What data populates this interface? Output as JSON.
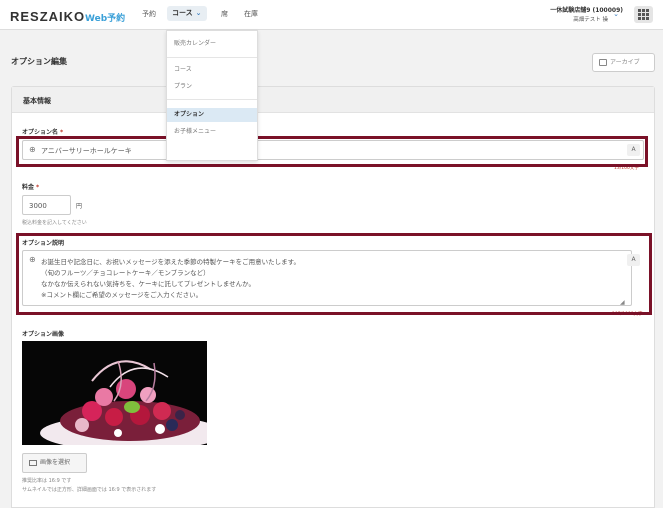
{
  "header": {
    "logo": "RESZAIKO",
    "logo_sub": "Web予約",
    "nav": {
      "reserve": "予約",
      "course": "コース",
      "seat": "席",
      "stock": "在庫"
    },
    "store_name": "一休試験店舗9 (100009)",
    "user_name": "高畑テスト 操"
  },
  "dropdown": {
    "items": [
      "販売カレンダー",
      "コース",
      "プラン",
      "オプション",
      "お子様メニュー"
    ]
  },
  "page": {
    "title": "オプション編集",
    "archive_label": "アーカイブ"
  },
  "card": {
    "section_title": "基本情報",
    "option_name": {
      "label": "オプション名",
      "required": "*",
      "value": "アニバーサリーホールケーキ",
      "counter": "13/100文字"
    },
    "price": {
      "label": "料金",
      "required": "*",
      "value": "3000",
      "unit": "円",
      "hint": "税込料金を記入してください"
    },
    "description": {
      "label": "オプション説明",
      "lines": [
        "お誕生日や記念日に、お祝いメッセージを添えた季節の特製ケーキをご用意いたします。",
        "（旬のフルーツ／チョコレートケーキ／モンブランなど）",
        "なかなか伝えられない気持ちを、ケーキに託してプレゼントしませんか。",
        "※コメント欄にご希望のメッセージをご入力ください。"
      ],
      "counter": "107/1000文字"
    },
    "image": {
      "label": "オプション画像",
      "select_label": "画像を選択",
      "hint1": "推奨比率は 16:9 です",
      "hint2": "サムネイルでは正方形、詳細画面では 16:9 で表示されます"
    }
  },
  "colors": {
    "highlight": "#7a1128",
    "accent": "#3aa0d8",
    "required": "#c0392b",
    "dropdown_active": "#dbe9f4"
  },
  "icons": {
    "globe": "globe-icon",
    "translate": "translate-icon",
    "archive": "archive-icon",
    "image": "image-icon",
    "grid": "grid-icon",
    "chevron": "chevron-down-icon"
  }
}
